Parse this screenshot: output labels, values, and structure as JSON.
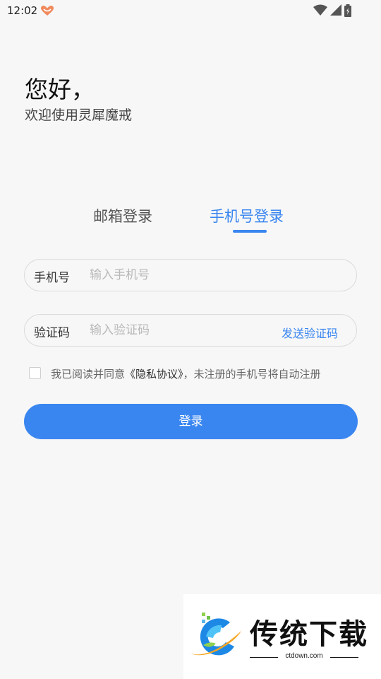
{
  "status_bar": {
    "time": "12:02",
    "icons": [
      "app-heart-icon",
      "wifi-icon",
      "cellular-signal-icon",
      "battery-charging-icon"
    ]
  },
  "greeting": {
    "title": "您好，",
    "subtitle": "欢迎使用灵犀魔戒"
  },
  "tabs": [
    {
      "label": "邮箱登录",
      "selected": false
    },
    {
      "label": "手机号登录",
      "selected": true
    }
  ],
  "form": {
    "phone": {
      "label": "手机号",
      "placeholder": "输入手机号",
      "value": ""
    },
    "code": {
      "label": "验证码",
      "placeholder": "输入验证码",
      "value": "",
      "send_label": "发送验证码"
    }
  },
  "agreement": {
    "checked": false,
    "prefix": "我已阅读并同意",
    "link": "《隐私协议》",
    "suffix": "，未注册的手机号将自动注册"
  },
  "login_button": "登录",
  "watermark": {
    "title": "传统下载",
    "domain": "ctdown.com"
  },
  "colors": {
    "accent": "#3a86f0",
    "background": "#f7f7f7"
  }
}
